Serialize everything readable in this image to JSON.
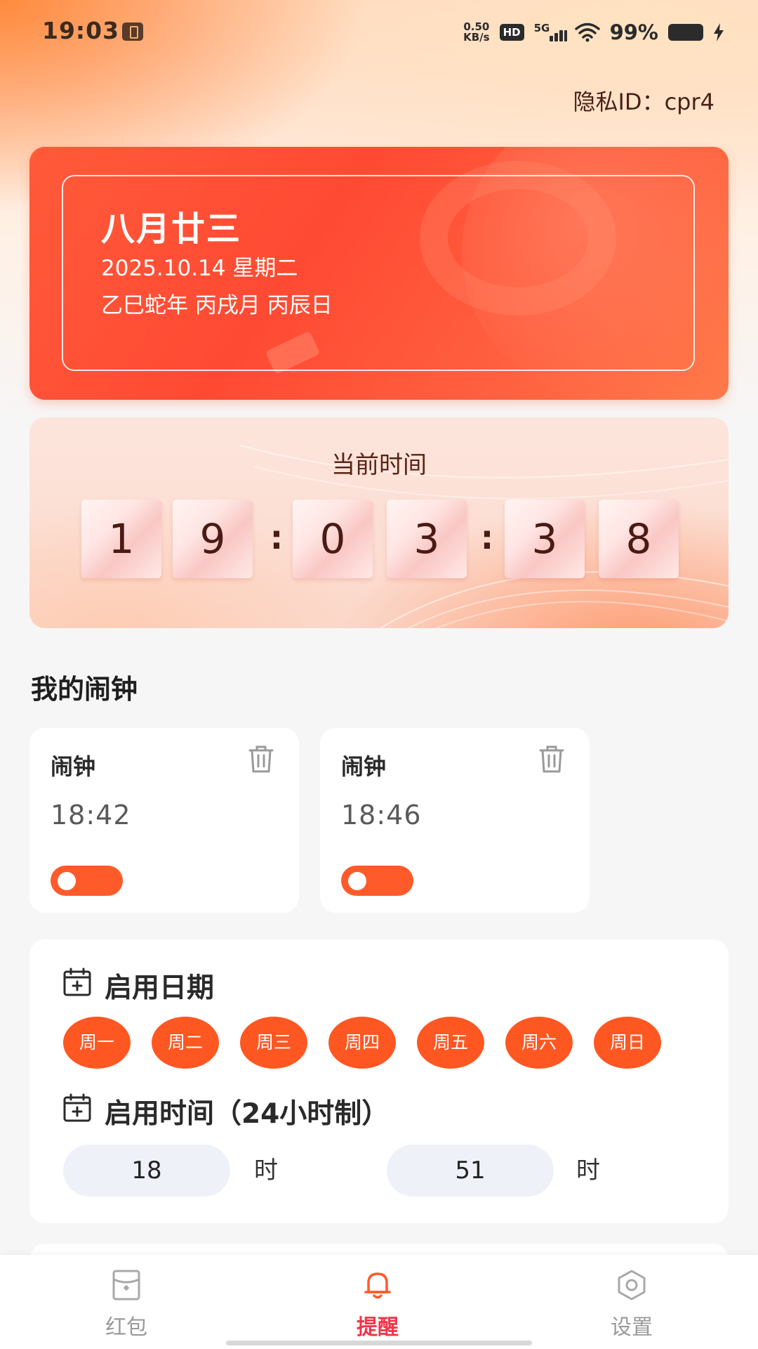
{
  "status_bar": {
    "time": "19:03",
    "net_speed_value": "0.50",
    "net_speed_unit": "KB/s",
    "hd": "HD",
    "network": "5G",
    "battery": "99%"
  },
  "privacy_id": "隐私ID：cpr4",
  "calendar": {
    "lunar_date": "八月廿三",
    "date": "2025.10.14 星期二",
    "ganzhi": "乙巳蛇年 丙戌月 丙辰日"
  },
  "clock": {
    "title": "当前时间",
    "digits": [
      "1",
      "9",
      "0",
      "3",
      "3",
      "8"
    ],
    "separator": ":"
  },
  "alarms": {
    "section_title": "我的闹钟",
    "items": [
      {
        "name": "闹钟",
        "time": "18:42",
        "enabled": true
      },
      {
        "name": "闹钟",
        "time": "18:46",
        "enabled": true
      }
    ]
  },
  "settings": {
    "date_label": "启用日期",
    "days": [
      "周一",
      "周二",
      "周三",
      "周四",
      "周五",
      "周六",
      "周日"
    ],
    "time_label": "启用时间（24小时制）",
    "hour": "18",
    "hour_unit": "时",
    "minute": "51",
    "minute_unit": "时"
  },
  "nav": {
    "items": [
      {
        "label": "红包",
        "icon": "red-packet-icon"
      },
      {
        "label": "提醒",
        "icon": "bell-icon",
        "active": true
      },
      {
        "label": "设置",
        "icon": "settings-icon"
      }
    ]
  },
  "colors": {
    "accent": "#ff5722",
    "nav_active": "#f0364a"
  }
}
